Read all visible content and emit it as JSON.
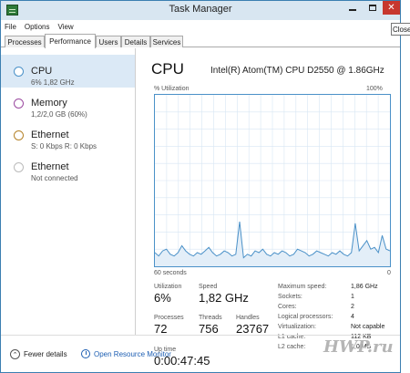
{
  "window": {
    "title": "Task Manager",
    "tooltip": "Close"
  },
  "menu": {
    "file": "File",
    "options": "Options",
    "view": "View"
  },
  "tabs": [
    "Processes",
    "Performance",
    "Users",
    "Details",
    "Services"
  ],
  "sidebar": {
    "items": [
      {
        "name": "CPU",
        "sub": "6% 1,82 GHz",
        "ring_color": "#4b91c8"
      },
      {
        "name": "Memory",
        "sub": "1,2/2,0 GB (60%)",
        "ring_color": "#9b4aa0"
      },
      {
        "name": "Ethernet",
        "sub": "S: 0 Kbps R: 0 Kbps",
        "ring_color": "#b5832a"
      },
      {
        "name": "Ethernet",
        "sub": "Not connected",
        "ring_color": "#bbbbbb"
      }
    ]
  },
  "main": {
    "title": "CPU",
    "model": "Intel(R) Atom(TM) CPU D2550 @ 1.86GHz",
    "util_label": "% Utilization",
    "util_max": "100%",
    "axis_left": "60 seconds",
    "axis_right": "0",
    "stats": {
      "utilization": {
        "label": "Utilization",
        "value": "6%"
      },
      "speed": {
        "label": "Speed",
        "value": "1,82 GHz"
      },
      "processes": {
        "label": "Processes",
        "value": "72"
      },
      "threads": {
        "label": "Threads",
        "value": "756"
      },
      "handles": {
        "label": "Handles",
        "value": "23767"
      },
      "uptime": {
        "label": "Up time",
        "value": "0:00:47:45"
      }
    },
    "specs": [
      {
        "k": "Maximum speed:",
        "v": "1,86 GHz"
      },
      {
        "k": "Sockets:",
        "v": "1"
      },
      {
        "k": "Cores:",
        "v": "2"
      },
      {
        "k": "Logical processors:",
        "v": "4"
      },
      {
        "k": "Virtualization:",
        "v": "Not capable"
      },
      {
        "k": "L1 cache:",
        "v": "112 KB"
      },
      {
        "k": "L2 cache:",
        "v": "1,0 MB"
      }
    ]
  },
  "graph_samples": [
    8,
    6,
    9,
    10,
    7,
    6,
    8,
    12,
    9,
    7,
    6,
    8,
    7,
    9,
    11,
    8,
    6,
    7,
    9,
    8,
    6,
    7,
    26,
    5,
    7,
    6,
    9,
    8,
    10,
    7,
    6,
    8,
    7,
    9,
    8,
    6,
    7,
    10,
    9,
    8,
    6,
    7,
    9,
    8,
    7,
    6,
    8,
    7,
    9,
    7,
    6,
    8,
    25,
    9,
    12,
    15,
    10,
    11,
    8,
    18,
    10,
    9
  ],
  "footer": {
    "fewer": "Fewer details",
    "resmon": "Open Resource Monitor"
  },
  "watermark": "HWP.ru",
  "colors": {
    "accent": "#4b91c8",
    "graph_fill": "#e3eef8",
    "grid": "#d7e6f3"
  }
}
